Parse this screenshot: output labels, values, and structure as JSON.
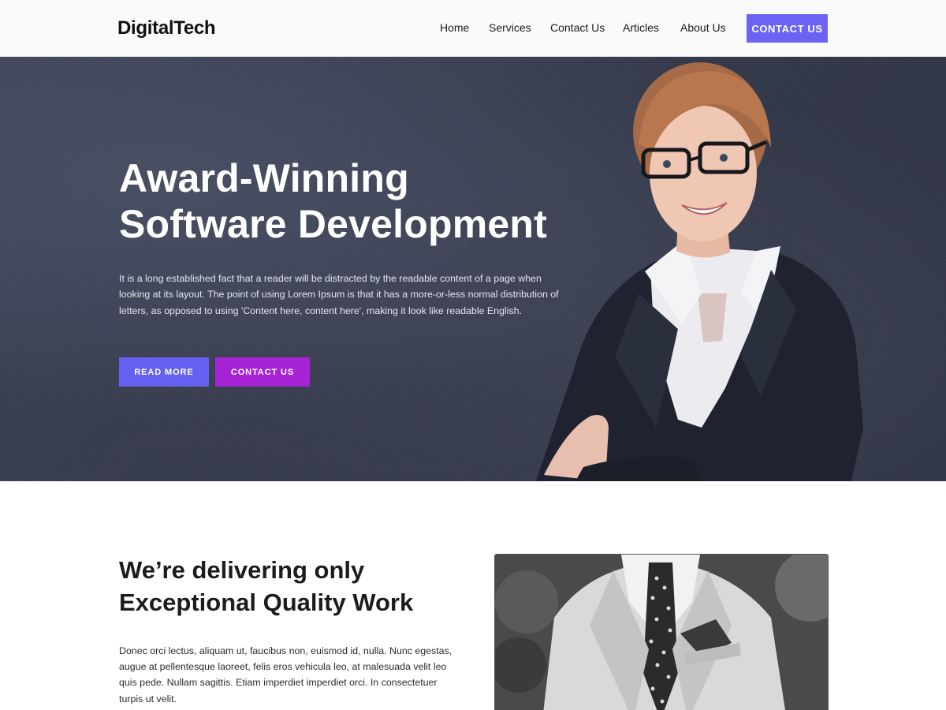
{
  "header": {
    "logo": "DigitalTech",
    "nav": [
      {
        "label": "Home"
      },
      {
        "label": "Services"
      },
      {
        "label": "Contact Us"
      },
      {
        "label": "Articles"
      },
      {
        "label": "About Us"
      }
    ],
    "cta_label": "CONTACT US",
    "accent_color": "#6c63f4"
  },
  "hero": {
    "title_line1": "Award-Winning",
    "title_line2": "Software Development",
    "description": "It is a long established fact that a reader will be distracted by the readable content of a page when looking at its layout. The point of using Lorem Ipsum is that it has a more-or-less normal distribution of letters, as opposed to using 'Content here, content here', making it look like readable English.",
    "read_more_label": "READ MORE",
    "contact_label": "CONTACT US",
    "read_more_color": "#6560f0",
    "contact_color": "#a624d6",
    "photo": "woman-in-glasses-portrait"
  },
  "about": {
    "title_line1": "We’re delivering only",
    "title_line2": "Exceptional Quality Work",
    "text": "Donec orci lectus, aliquam ut, faucibus non, euismod id, nulla. Nunc egestas, augue at pellentesque laoreet, felis eros vehicula leo, at malesuada velit leo quis pede. Nullam sagittis. Etiam imperdiet imperdiet orci. In consectetuer turpis ut velit.",
    "photo": "man-in-suit-grayscale-photo"
  }
}
